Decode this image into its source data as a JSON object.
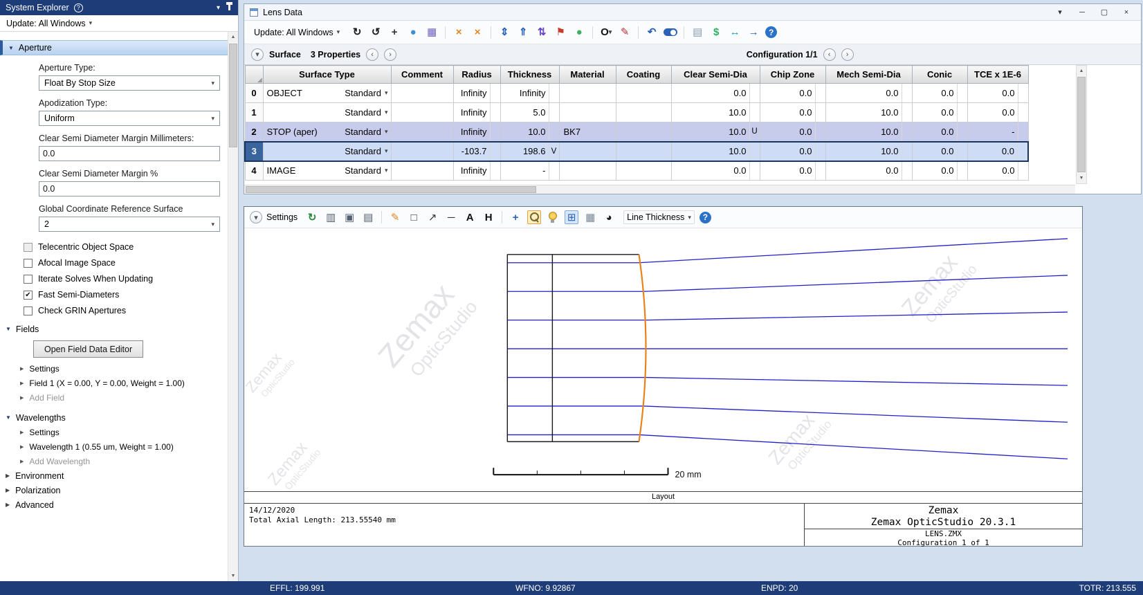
{
  "icons": {
    "help": "?",
    "dropdown": "▾",
    "expanded": "▼",
    "collapsed": "▶",
    "tree_item": "▶",
    "prev": "‹",
    "next": "›",
    "corner": "◢",
    "check": "✔",
    "scroll_up": "▲",
    "scroll_down": "▼"
  },
  "system_explorer": {
    "title": "System Explorer",
    "update": "Update: All Windows",
    "aperture": {
      "title": "Aperture",
      "aperture_type_label": "Aperture Type:",
      "aperture_type_value": "Float By Stop Size",
      "apodization_label": "Apodization Type:",
      "apodization_value": "Uniform",
      "margin_mm_label": "Clear Semi Diameter Margin Millimeters:",
      "margin_mm_value": "0.0",
      "margin_pct_label": "Clear Semi Diameter Margin %",
      "margin_pct_value": "0.0",
      "gcrs_label": "Global Coordinate Reference Surface",
      "gcrs_value": "2",
      "checkboxes": [
        {
          "label": "Telecentric Object Space",
          "checked": false,
          "disabled": true
        },
        {
          "label": "Afocal Image Space",
          "checked": false,
          "disabled": false
        },
        {
          "label": "Iterate Solves When Updating",
          "checked": false,
          "disabled": false
        },
        {
          "label": "Fast Semi-Diameters",
          "checked": true,
          "disabled": false
        },
        {
          "label": "Check GRIN Apertures",
          "checked": false,
          "disabled": false
        }
      ]
    },
    "fields_section": {
      "title": "Fields",
      "button": "Open Field Data Editor",
      "items": [
        {
          "label": "Settings",
          "muted": false
        },
        {
          "label": "Field 1 (X = 0.00, Y = 0.00, Weight = 1.00)",
          "muted": false
        },
        {
          "label": "Add Field",
          "muted": true
        }
      ]
    },
    "wavelengths_section": {
      "title": "Wavelengths",
      "items": [
        {
          "label": "Settings",
          "muted": false
        },
        {
          "label": "Wavelength 1 (0.55 um, Weight = 1.00)",
          "muted": false
        },
        {
          "label": "Add Wavelength",
          "muted": true
        }
      ]
    },
    "collapsed_sections": [
      "Environment",
      "Polarization",
      "Advanced"
    ]
  },
  "lens_data": {
    "title": "Lens Data",
    "update": "Update: All Windows",
    "window_controls": [
      {
        "name": "window-menu-icon",
        "glyph": "▾"
      },
      {
        "name": "minimize-icon",
        "glyph": "─"
      },
      {
        "name": "maximize-icon",
        "glyph": "▢"
      },
      {
        "name": "close-icon",
        "glyph": "×"
      }
    ],
    "toolbar_icons": [
      {
        "name": "update-refresh-icon",
        "glyph": "↻",
        "color": "#1b1b1b",
        "bold": true
      },
      {
        "name": "update-clock-icon",
        "glyph": "↺",
        "color": "#1b1b1b",
        "bold": true
      },
      {
        "name": "adjust-crosshair-icon",
        "glyph": "+",
        "color": "#333333",
        "bold": true
      },
      {
        "name": "globe-icon",
        "glyph": "●",
        "color": "#3f8fd2"
      },
      {
        "name": "analysis-grid-icon",
        "glyph": "▦",
        "color": "#6f61c0"
      },
      {
        "sep": true
      },
      {
        "name": "ray-fan-icon",
        "glyph": "×",
        "color": "#e0851f",
        "bold": true
      },
      {
        "name": "ray-fan-off-icon",
        "glyph": "×",
        "color": "#e0851f",
        "bold": true
      },
      {
        "sep": true
      },
      {
        "name": "field-updown-icon",
        "glyph": "⇕",
        "color": "#2a62b8",
        "bold": true
      },
      {
        "name": "aperture-up-icon",
        "glyph": "⇑",
        "color": "#2a62b8",
        "bold": true
      },
      {
        "name": "stop-shift-icon",
        "glyph": "⇅",
        "color": "#6a45c8",
        "bold": true
      },
      {
        "name": "optimize-flag-icon",
        "glyph": "⚑",
        "color": "#c83a2a"
      },
      {
        "name": "globe-coordinates-icon",
        "glyph": "●",
        "color": "#3fae62"
      },
      {
        "sep": true
      },
      {
        "name": "aperture-circle-icon",
        "glyph": "O",
        "color": "#111111",
        "bold": true,
        "dropdown": true
      },
      {
        "name": "draw-pen-icon",
        "glyph": "✎",
        "color": "#b83030"
      },
      {
        "sep": true
      },
      {
        "name": "undo-icon",
        "glyph": "↶",
        "color": "#2a62b8",
        "bold": true
      },
      {
        "name": "toggle-icon",
        "shape": "toggle"
      },
      {
        "sep": true
      },
      {
        "name": "prescription-icon",
        "glyph": "▤",
        "color": "#8a9ab0"
      },
      {
        "name": "solve-dollar-icon",
        "glyph": "$",
        "color": "#2fae5f",
        "bold": true
      },
      {
        "name": "swap-arrows-icon",
        "glyph": "↔",
        "color": "#17a0a8",
        "bold": true
      },
      {
        "name": "goto-arrow-icon",
        "glyph": "→",
        "color": "#2a62b8",
        "bold": true
      },
      {
        "name": "help-icon",
        "glyph": "?",
        "color": "#ffffff",
        "bg": "#2a72c8",
        "round": true
      }
    ],
    "surface_word": "Surface",
    "surface_props": "3 Properties",
    "configuration": "Configuration 1/1",
    "table": {
      "columns": [
        "Surface Type",
        "Comment",
        "Radius",
        "Thickness",
        "Material",
        "Coating",
        "Clear Semi-Dia",
        "Chip Zone",
        "Mech Semi-Dia",
        "Conic",
        "TCE x 1E-6"
      ],
      "rows": [
        {
          "n": "0",
          "label": "OBJECT",
          "type": "Standard",
          "comment": "",
          "radius": "Infinity",
          "radius_f": "",
          "thickness": "Infinity",
          "thickness_f": "",
          "material": "",
          "coating": "",
          "clear": "0.0",
          "clear_f": "",
          "chip": "0.0",
          "chip_f": "",
          "mech": "0.0",
          "mech_f": "",
          "conic": "0.0",
          "conic_f": "",
          "tce": "0.0",
          "tce_f": "",
          "highlight": ""
        },
        {
          "n": "1",
          "label": "",
          "type": "Standard",
          "comment": "",
          "radius": "Infinity",
          "radius_f": "",
          "thickness": "5.0",
          "thickness_f": "",
          "material": "",
          "coating": "",
          "clear": "10.0",
          "clear_f": "",
          "chip": "0.0",
          "chip_f": "",
          "mech": "10.0",
          "mech_f": "",
          "conic": "0.0",
          "conic_f": "",
          "tce": "0.0",
          "tce_f": "",
          "highlight": ""
        },
        {
          "n": "2",
          "label": "STOP (aper)",
          "type": "Standard",
          "comment": "",
          "radius": "Infinity",
          "radius_f": "",
          "thickness": "10.0",
          "thickness_f": "",
          "material": "BK7",
          "coating": "",
          "clear": "10.0",
          "clear_f": "U",
          "chip": "0.0",
          "chip_f": "",
          "mech": "10.0",
          "mech_f": "",
          "conic": "0.0",
          "conic_f": "",
          "tce": "-",
          "tce_f": "",
          "highlight": "stop"
        },
        {
          "n": "3",
          "label": "",
          "type": "Standard",
          "comment": "",
          "radius": "-103.7",
          "radius_f": "",
          "thickness": "198.6",
          "thickness_f": "V",
          "material": "",
          "coating": "",
          "clear": "10.0",
          "clear_f": "",
          "chip": "0.0",
          "chip_f": "",
          "mech": "10.0",
          "mech_f": "",
          "conic": "0.0",
          "conic_f": "",
          "tce": "0.0",
          "tce_f": "",
          "highlight": "selected"
        },
        {
          "n": "4",
          "label": "IMAGE",
          "type": "Standard",
          "comment": "",
          "radius": "Infinity",
          "radius_f": "",
          "thickness": "-",
          "thickness_f": "",
          "material": "",
          "coating": "",
          "clear": "0.0",
          "clear_f": "",
          "chip": "0.0",
          "chip_f": "",
          "mech": "0.0",
          "mech_f": "",
          "conic": "0.0",
          "conic_f": "",
          "tce": "0.0",
          "tce_f": "",
          "highlight": ""
        }
      ]
    }
  },
  "layout": {
    "settings": "Settings",
    "toolbar_icons": [
      {
        "name": "refresh-icon",
        "glyph": "↻",
        "color": "#2a8a3a",
        "bold": true
      },
      {
        "name": "copy-icon",
        "glyph": "▥",
        "color": "#556070"
      },
      {
        "name": "save-icon",
        "glyph": "▣",
        "color": "#556070"
      },
      {
        "name": "print-icon",
        "glyph": "▤",
        "color": "#556070"
      },
      {
        "sep": true
      },
      {
        "name": "pencil-icon",
        "glyph": "✎",
        "color": "#e0851f"
      },
      {
        "name": "rectangle-tool-icon",
        "glyph": "□",
        "color": "#333333"
      },
      {
        "name": "arrow-tool-icon",
        "glyph": "↗",
        "color": "#333333"
      },
      {
        "name": "line-tool-icon",
        "glyph": "─",
        "color": "#333333"
      },
      {
        "name": "text-tool-icon",
        "glyph": "A",
        "color": "#111111",
        "bold": true
      },
      {
        "name": "dimension-tool-icon",
        "glyph": "H",
        "color": "#111111",
        "bold": true
      },
      {
        "sep": true
      },
      {
        "name": "pan-icon",
        "glyph": "+",
        "color": "#2a62b8",
        "bold": true
      },
      {
        "name": "zoom-magnifier-icon",
        "shape": "magnifier",
        "active": "orange"
      },
      {
        "name": "bulb-icon",
        "shape": "bulb"
      },
      {
        "name": "window-split-icon",
        "glyph": "⊞",
        "color": "#2a62b8",
        "active": "blue"
      },
      {
        "name": "screen-icon",
        "glyph": "▦",
        "color": "#7a8796"
      },
      {
        "name": "clock-icon",
        "glyph": "◕",
        "color": "#1b1b1b"
      }
    ],
    "line_thickness": "Line Thickness",
    "watermark_line1": "Zemax",
    "watermark_line2": "OpticStudio",
    "scale_label": "20 mm",
    "caption": "Layout",
    "footer": {
      "date": "14/12/2020",
      "total": "Total Axial Length:  213.55540 mm",
      "brand": "Zemax",
      "product": "Zemax OpticStudio 20.3.1",
      "file": "LENS.ZMX",
      "config": "Configuration 1 of 1"
    }
  },
  "status_bar": {
    "effl": "EFFL: 199.991",
    "wfno": "WFNO: 9.92867",
    "enpd": "ENPD: 20",
    "totr": "TOTR: 213.555"
  }
}
